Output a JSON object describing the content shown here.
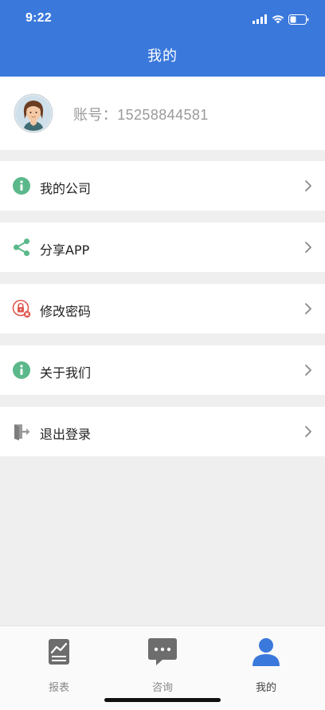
{
  "status_bar": {
    "time": "9:22"
  },
  "header": {
    "title": "我的"
  },
  "profile": {
    "account_text": "账号：15258844581"
  },
  "menu": [
    {
      "label": "我的公司",
      "icon": "info-icon"
    },
    {
      "label": "分享APP",
      "icon": "share-icon"
    },
    {
      "label": "修改密码",
      "icon": "lock-icon"
    },
    {
      "label": "关于我们",
      "icon": "info-icon"
    },
    {
      "label": "退出登录",
      "icon": "exit-icon"
    }
  ],
  "tabbar": [
    {
      "label": "报表",
      "icon": "chart-report-icon",
      "active": false
    },
    {
      "label": "咨询",
      "icon": "chat-bubble-icon",
      "active": false
    },
    {
      "label": "我的",
      "icon": "user-icon",
      "active": true
    }
  ],
  "colors": {
    "header_bg": "#3a78dc",
    "accent_green": "#5bb88a",
    "accent_red": "#e0574f",
    "active_tab": "#3a78dc",
    "inactive_tab": "#666666"
  }
}
